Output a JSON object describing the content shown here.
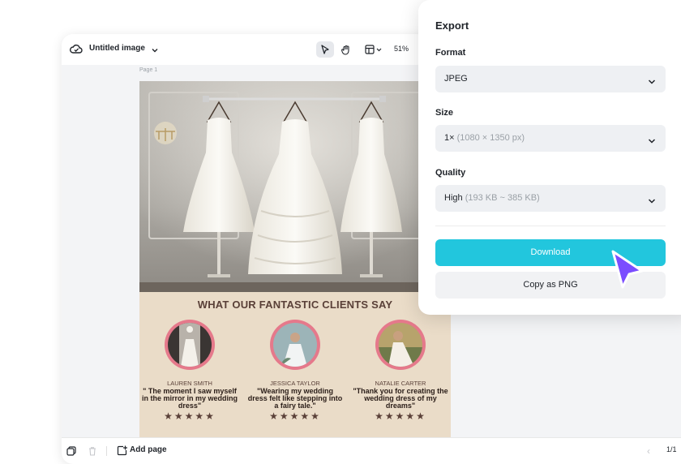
{
  "editor": {
    "doc_title": "Untitled image",
    "zoom": "51%",
    "page_label": "Page 1",
    "add_page": "Add page",
    "page_count": "1/1",
    "prev_page": "‹"
  },
  "design": {
    "headline": "WHAT OUR FANTASTIC CLIENTS SAY",
    "clients": [
      {
        "name": "LAUREN SMITH",
        "quote": "\" The moment I saw myself in the mirror in my wedding dress\"",
        "stars": "★★★★★"
      },
      {
        "name": "JESSICA TAYLOR",
        "quote": "\"Wearing my wedding dress felt like stepping into a fairy tale.\"",
        "stars": "★★★★★"
      },
      {
        "name": "NATALIE CARTER",
        "quote": "\"Thank you for creating the wedding dress of my dreams\"",
        "stars": "★★★★★"
      }
    ]
  },
  "export": {
    "title": "Export",
    "format": {
      "label": "Format",
      "value": "JPEG"
    },
    "size": {
      "label": "Size",
      "value": "1×",
      "detail": "(1080 × 1350 px)"
    },
    "quality": {
      "label": "Quality",
      "value": "High",
      "detail": "(193 KB ~ 385 KB)"
    },
    "download": "Download",
    "copy_png": "Copy as PNG"
  },
  "colors": {
    "accent": "#22c6dd",
    "cursor": "#7b4dff",
    "avatar_ring": "#e5798b",
    "canvas_bg": "#eadcc8"
  },
  "icons": [
    "cloud-icon",
    "chevron-down-icon",
    "pointer-icon",
    "hand-icon",
    "layout-icon",
    "layers-icon",
    "trash-icon",
    "add-page-icon"
  ]
}
